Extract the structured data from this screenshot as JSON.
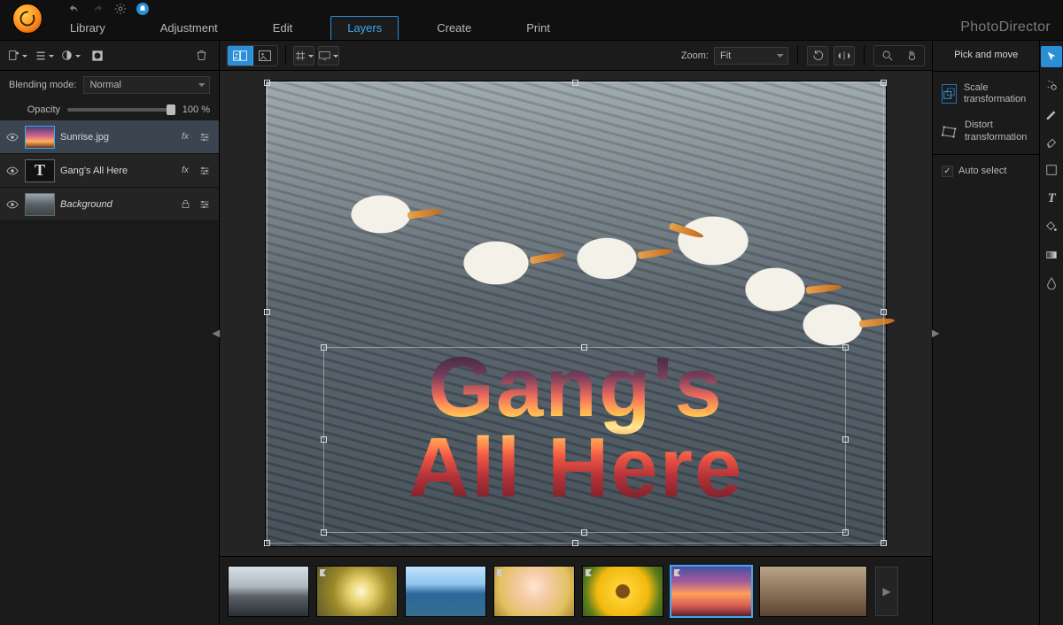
{
  "app": {
    "name": "PhotoDirector"
  },
  "menu": {
    "items": [
      "Library",
      "Adjustment",
      "Edit",
      "Layers",
      "Create",
      "Print"
    ],
    "active": 3
  },
  "layers_panel": {
    "blend_label": "Blending mode:",
    "blend_value": "Normal",
    "opacity_label": "Opacity",
    "opacity_value": "100 %",
    "opacity_pct": 100,
    "layers": [
      {
        "name": "Sunrise.jpg",
        "selected": true,
        "italic": false,
        "thumb": "sunrise",
        "right": [
          "fx",
          "sliders"
        ]
      },
      {
        "name": "Gang's All Here",
        "selected": false,
        "italic": false,
        "thumb": "text",
        "right": [
          "fx",
          "sliders"
        ]
      },
      {
        "name": "Background",
        "selected": false,
        "italic": true,
        "thumb": "water",
        "right": [
          "lock",
          "sliders"
        ]
      }
    ]
  },
  "canvas": {
    "zoom_label": "Zoom:",
    "zoom_value": "Fit",
    "overlay_line1": "Gang's",
    "overlay_line2": "All Here"
  },
  "right_panel": {
    "title": "Pick and move",
    "scale": "Scale transformation",
    "distort": "Distort transformation",
    "auto_select": "Auto select"
  },
  "filmstrip": {
    "items": [
      "bw",
      "spiral",
      "coast",
      "woman",
      "sunflower",
      "sunset",
      "market"
    ],
    "selected": 5
  }
}
